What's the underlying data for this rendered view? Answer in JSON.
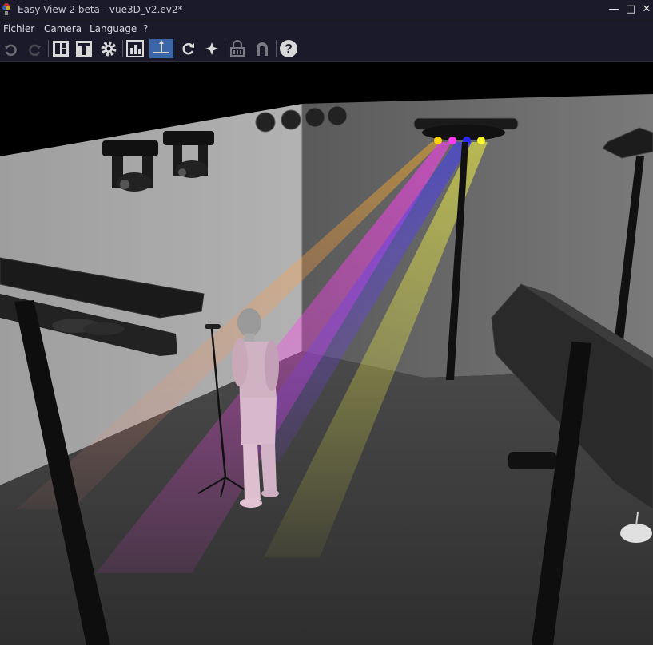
{
  "window": {
    "title": "Easy View 2 beta - vue3D_v2.ev2*",
    "minimize_glyph": "—",
    "maximize_glyph": "□",
    "close_glyph": "✕"
  },
  "menu": {
    "items": [
      "Fichier",
      "Camera",
      "Language",
      "?"
    ]
  },
  "toolbar": {
    "buttons": [
      {
        "icon": "undo-icon",
        "enabled": false
      },
      {
        "icon": "redo-icon",
        "enabled": false
      },
      {
        "icon": "layout-icon",
        "enabled": true
      },
      {
        "icon": "stage-view-icon",
        "enabled": true
      },
      {
        "icon": "settings-gear-icon",
        "enabled": true
      },
      {
        "icon": "chart-icon",
        "enabled": true
      },
      {
        "icon": "move-axes-icon",
        "enabled": true,
        "active": true
      },
      {
        "icon": "rotate-icon",
        "enabled": true
      },
      {
        "icon": "light-icon",
        "enabled": true
      },
      {
        "icon": "lock-icon",
        "enabled": false
      },
      {
        "icon": "magnet-icon",
        "enabled": false
      },
      {
        "icon": "help-icon",
        "enabled": true
      }
    ],
    "help_glyph": "?"
  },
  "scene": {
    "beam_colors": [
      "#ffd400",
      "#ff3cf0",
      "#2a2aff",
      "#ffff30"
    ],
    "wall_color": "#9a9a9a",
    "floor_color": "#3a3a3a"
  }
}
